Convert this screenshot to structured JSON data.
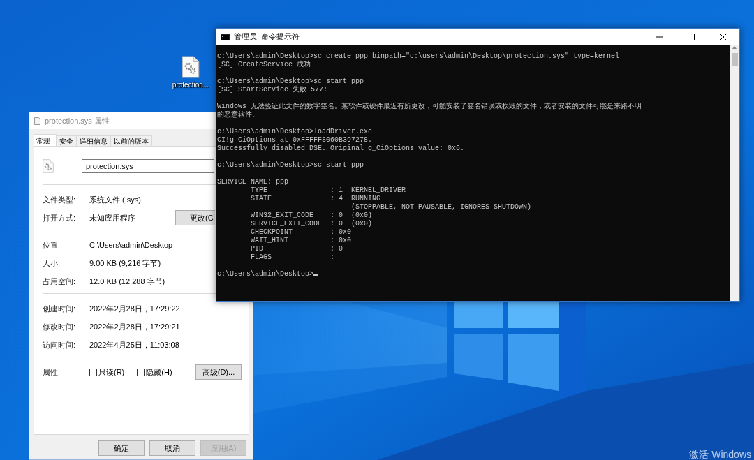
{
  "desktop": {
    "icons": [
      {
        "label": "protection..."
      }
    ],
    "activation_notice": "激活 Windows"
  },
  "properties_dialog": {
    "title": "protection.sys 属性",
    "tabs": [
      {
        "label": "常规",
        "selected": true
      },
      {
        "label": "安全",
        "selected": false
      },
      {
        "label": "详细信息",
        "selected": false
      },
      {
        "label": "以前的版本",
        "selected": false
      }
    ],
    "file_name": "protection.sys",
    "sections": [
      {
        "rows": [
          {
            "label": "文件类型:",
            "value": "系统文件 (.sys)"
          },
          {
            "label": "打开方式:",
            "value": "未知应用程序",
            "button": "更改(C"
          }
        ]
      },
      {
        "rows": [
          {
            "label": "位置:",
            "value": "C:\\Users\\admin\\Desktop"
          },
          {
            "label": "大小:",
            "value": "9.00 KB (9,216 字节)"
          },
          {
            "label": "占用空间:",
            "value": "12.0 KB (12,288 字节)"
          }
        ]
      },
      {
        "rows": [
          {
            "label": "创建时间:",
            "value": "2022年2月28日，17:29:22"
          },
          {
            "label": "修改时间:",
            "value": "2022年2月28日，17:29:21"
          },
          {
            "label": "访问时间:",
            "value": "2022年4月25日，11:03:08"
          }
        ]
      }
    ],
    "attributes": {
      "label": "属性:",
      "checkboxes": [
        {
          "label": "只读(R)",
          "checked": false
        },
        {
          "label": "隐藏(H)",
          "checked": false
        }
      ],
      "button": "高级(D)..."
    },
    "buttons": [
      {
        "label": "确定",
        "disabled": false
      },
      {
        "label": "取消",
        "disabled": false
      },
      {
        "label": "应用(A)",
        "disabled": true
      }
    ]
  },
  "console": {
    "title": "管理员: 命令提示符",
    "cursor_visible": true,
    "blocks": [
      {
        "lines": [
          "c:\\Users\\admin\\Desktop>sc create ppp binpath=\"c:\\users\\admin\\Desktop\\protection.sys\" type=kernel",
          "[SC] CreateService 成功"
        ]
      },
      {
        "lines": [
          "c:\\Users\\admin\\Desktop>sc start ppp",
          "[SC] StartService 失败 577:"
        ]
      },
      {
        "lines": [
          "Windows 无法验证此文件的数字签名。某软件或硬件最近有所更改，可能安装了签名错误或损毁的文件，或者安装的文件可能是来路不明",
          "的恶意软件。"
        ]
      },
      {
        "lines": [
          "c:\\Users\\admin\\Desktop>loadDriver.exe",
          "CI!g_CiOptions at 0xFFFFF8060B397278.",
          "Successfully disabled DSE. Original g_CiOptions value: 0x6."
        ]
      },
      {
        "lines": [
          "c:\\Users\\admin\\Desktop>sc start ppp"
        ]
      },
      {
        "lines": [
          "SERVICE_NAME: ppp",
          "        TYPE               : 1  KERNEL_DRIVER",
          "        STATE              : 4  RUNNING",
          "                                (STOPPABLE, NOT_PAUSABLE, IGNORES_SHUTDOWN)",
          "        WIN32_EXIT_CODE    : 0  (0x0)",
          "        SERVICE_EXIT_CODE  : 0  (0x0)",
          "        CHECKPOINT         : 0x0",
          "        WAIT_HINT          : 0x0",
          "        PID                : 0",
          "        FLAGS              :"
        ]
      },
      {
        "lines": [
          "c:\\Users\\admin\\Desktop>"
        ]
      }
    ]
  }
}
